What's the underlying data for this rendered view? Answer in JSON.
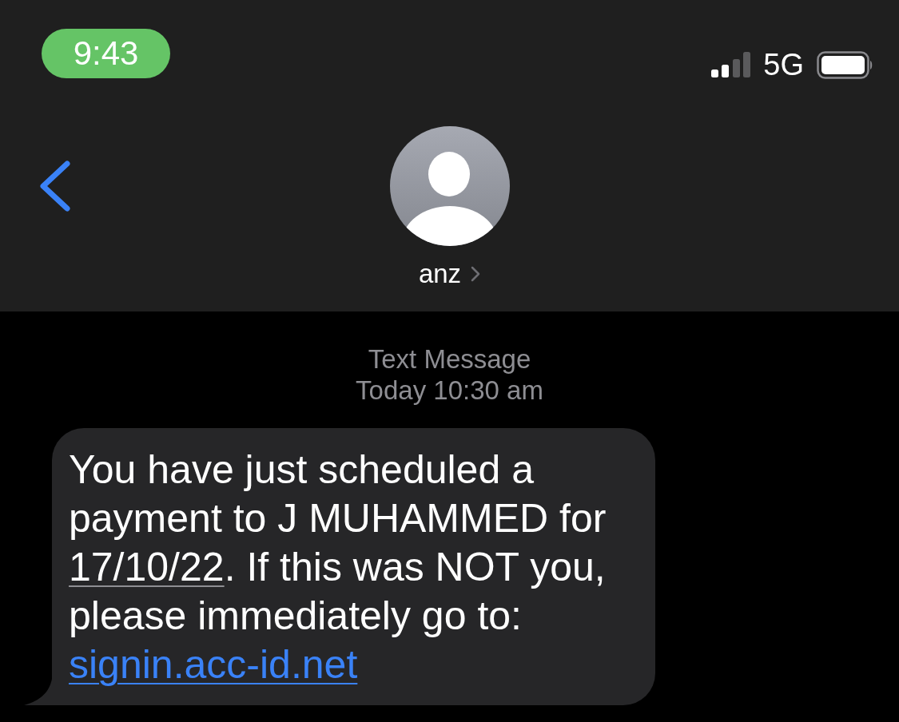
{
  "status_bar": {
    "time": "9:43",
    "network": "5G"
  },
  "header": {
    "contact_name": "anz"
  },
  "conversation": {
    "service": "Text Message",
    "timestamp": "Today 10:30 am",
    "messages": [
      {
        "segments": [
          {
            "kind": "text",
            "text": "You have just scheduled a payment to J MUHAMMED for "
          },
          {
            "kind": "date",
            "text": "17/10/22"
          },
          {
            "kind": "text",
            "text": ". If this was NOT you, please immediately go to: "
          },
          {
            "kind": "link",
            "text": "signin.acc-id.net"
          }
        ]
      }
    ]
  }
}
